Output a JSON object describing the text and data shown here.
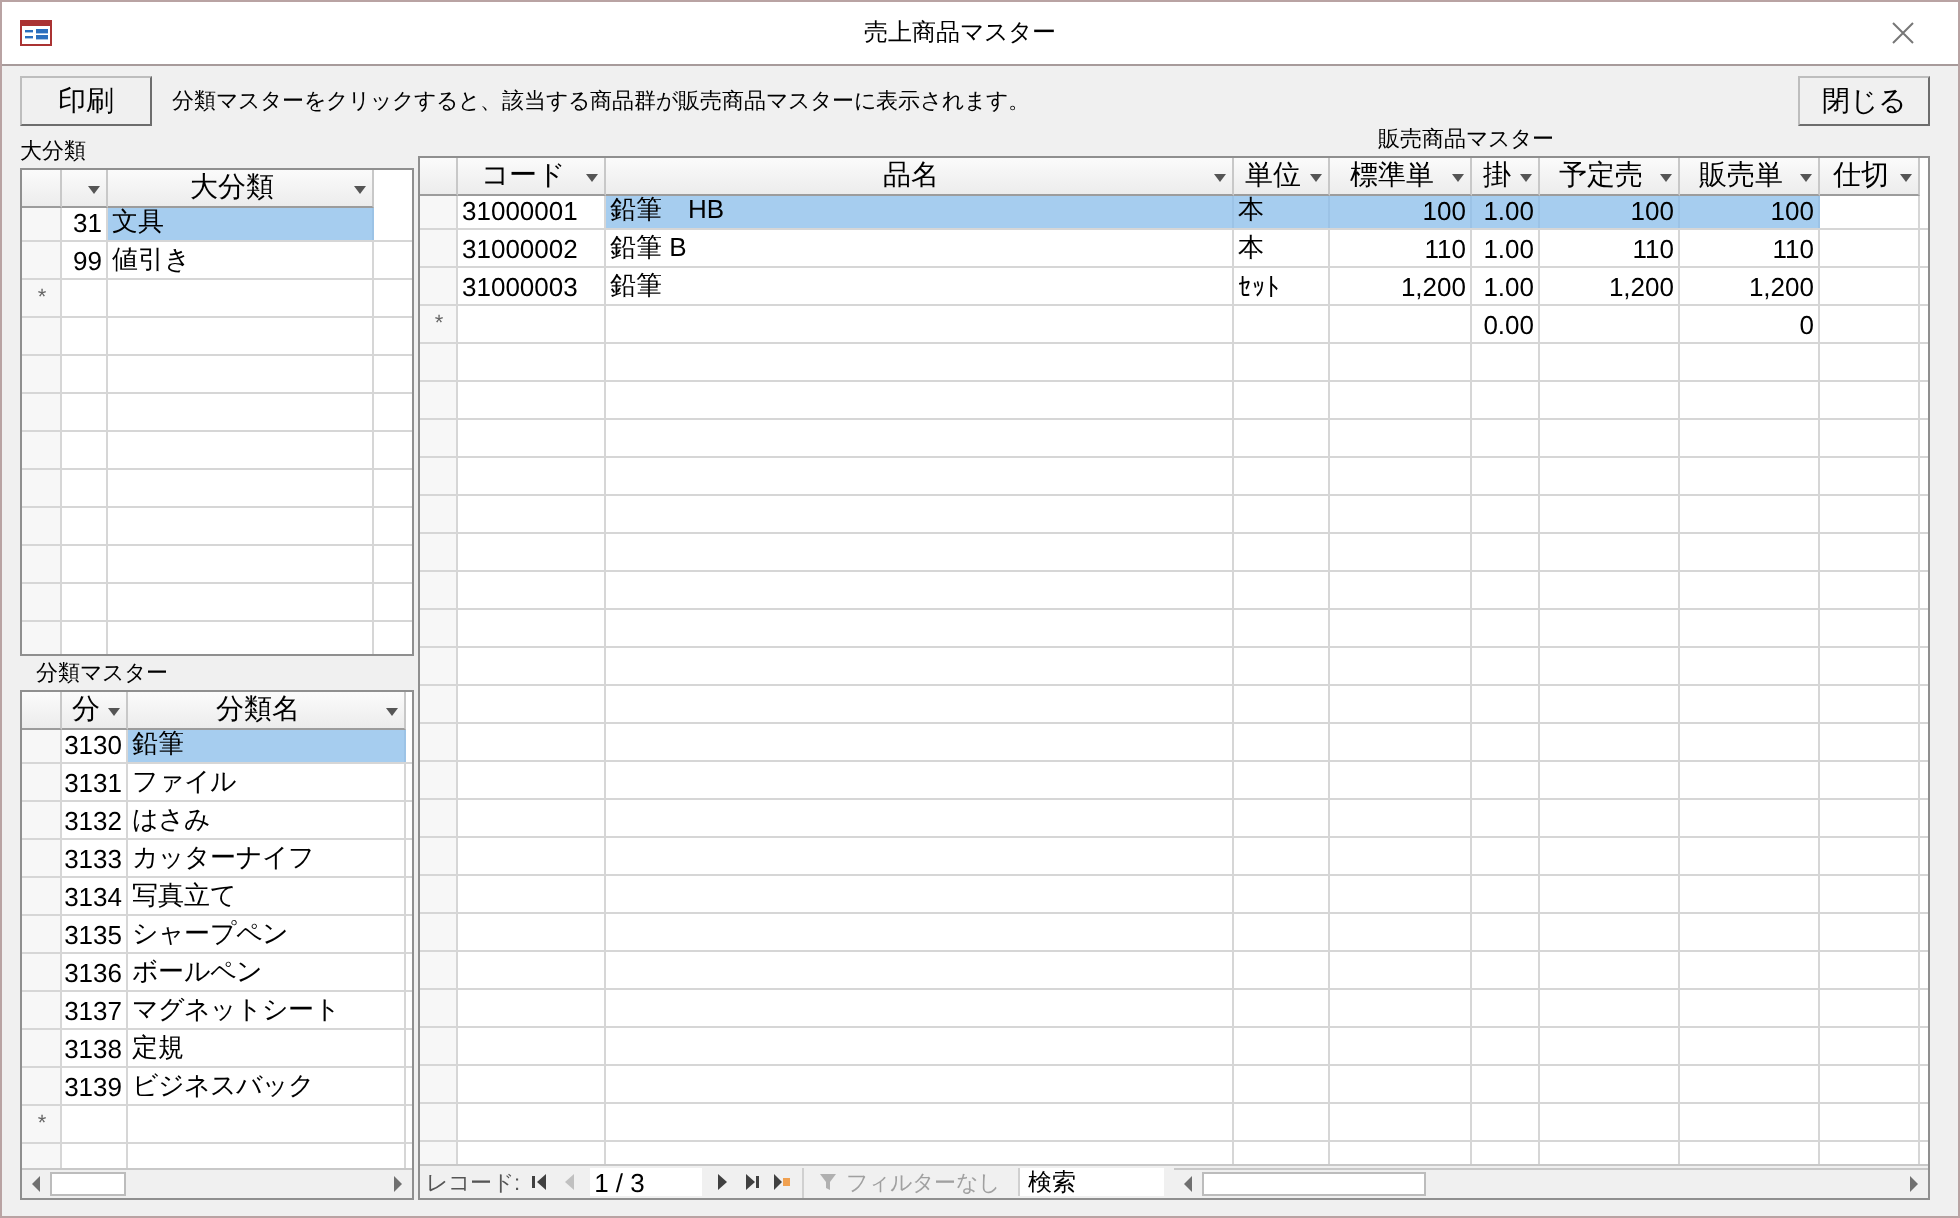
{
  "window": {
    "title": "売上商品マスター"
  },
  "toolbar": {
    "print_button": "印刷",
    "instruction": "分類マスターをクリックすると、該当する商品群が販売商品マスターに表示されます。",
    "close_button": "閉じる"
  },
  "category_table": {
    "label": "大分類",
    "columns": [
      {
        "kind": "number"
      },
      {
        "header": "大分類",
        "kind": "text"
      }
    ],
    "rows": [
      {
        "cells": [
          "31",
          "文具"
        ],
        "selected": true
      },
      {
        "cells": [
          "99",
          "値引き"
        ],
        "selected": false
      }
    ],
    "new_row": {
      "marker": "*",
      "cells": [
        null,
        null
      ]
    }
  },
  "class_table": {
    "label": "分類マスター",
    "columns": [
      {
        "header": "分",
        "kind": "number"
      },
      {
        "header": "分類名",
        "kind": "text"
      }
    ],
    "rows": [
      {
        "cells": [
          "3130",
          "鉛筆"
        ],
        "selected": true
      },
      {
        "cells": [
          "3131",
          "ファイル"
        ],
        "selected": false
      },
      {
        "cells": [
          "3132",
          "はさみ"
        ],
        "selected": false
      },
      {
        "cells": [
          "3133",
          "カッターナイフ"
        ],
        "selected": false
      },
      {
        "cells": [
          "3134",
          "写真立て"
        ],
        "selected": false
      },
      {
        "cells": [
          "3135",
          "シャープペン"
        ],
        "selected": false
      },
      {
        "cells": [
          "3136",
          "ボールペン"
        ],
        "selected": false
      },
      {
        "cells": [
          "3137",
          "マグネットシート"
        ],
        "selected": false
      },
      {
        "cells": [
          "3138",
          "定規"
        ],
        "selected": false
      },
      {
        "cells": [
          "3139",
          "ビジネスバック"
        ],
        "selected": false
      }
    ],
    "new_row": {
      "marker": "*",
      "cells": [
        null,
        null
      ]
    }
  },
  "product_table": {
    "label": "販売商品マスター",
    "columns": [
      {
        "header": "コード",
        "kind": "text"
      },
      {
        "header": "品名",
        "kind": "text"
      },
      {
        "header": "単位",
        "kind": "text"
      },
      {
        "header": "標準単",
        "kind": "number"
      },
      {
        "header": "掛",
        "kind": "number"
      },
      {
        "header": "予定売",
        "kind": "number"
      },
      {
        "header": "販売単",
        "kind": "number"
      },
      {
        "header": "仕切"
      }
    ],
    "rows": [
      {
        "cells": [
          "31000001",
          "鉛筆　HB",
          "本",
          "100",
          "1.00",
          "100",
          "100",
          null
        ],
        "selected": true
      },
      {
        "cells": [
          "31000002",
          "鉛筆 B",
          "本",
          "110",
          "1.00",
          "110",
          "110",
          null
        ],
        "selected": false
      },
      {
        "cells": [
          "31000003",
          "鉛筆",
          "ｾｯﾄ",
          "1,200",
          "1.00",
          "1,200",
          "1,200",
          null
        ],
        "selected": false
      }
    ],
    "new_row": {
      "marker": "*",
      "cells": [
        null,
        null,
        null,
        null,
        "0.00",
        null,
        "0",
        null
      ]
    },
    "navigation": {
      "label": "レコード:",
      "position": "1 / 3",
      "buttons": [
        {
          "kind": "first",
          "disabled": false
        },
        {
          "kind": "previous",
          "disabled": true
        }
      ],
      "buttons_after": [
        {
          "kind": "next",
          "disabled": false
        },
        {
          "kind": "last",
          "disabled": false
        },
        {
          "kind": "new",
          "disabled": false
        }
      ],
      "filter": {
        "text": "フィルターなし",
        "active": false
      },
      "search": {
        "placeholder": "検索"
      }
    }
  }
}
